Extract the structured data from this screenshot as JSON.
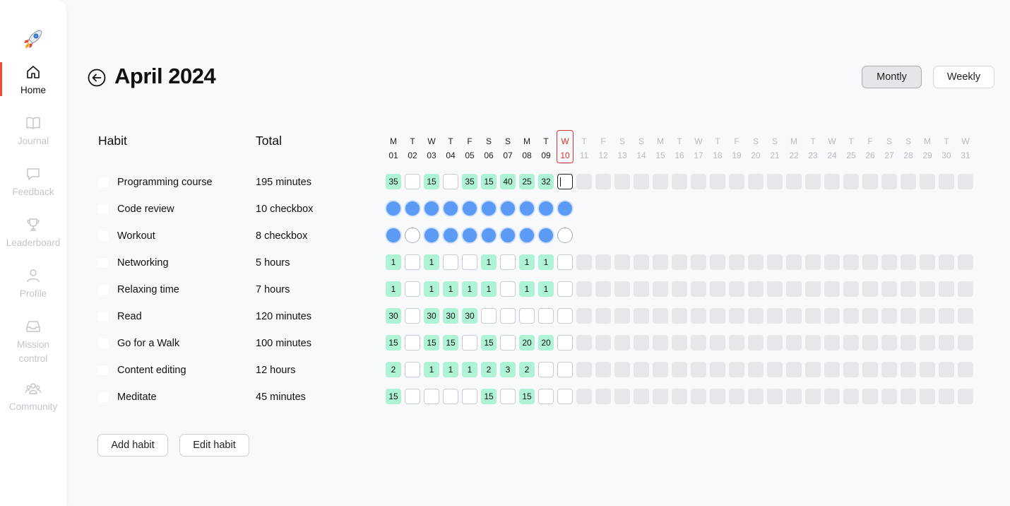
{
  "sidebar": {
    "logo": "rocket-icon",
    "items": [
      {
        "label": "Home",
        "icon": "home-icon",
        "active": true
      },
      {
        "label": "Journal",
        "icon": "book-icon",
        "active": false
      },
      {
        "label": "Feedback",
        "icon": "chat-icon",
        "active": false
      },
      {
        "label": "Leaderboard",
        "icon": "trophy-icon",
        "active": false
      },
      {
        "label": "Profile",
        "icon": "user-icon",
        "active": false
      },
      {
        "label": "Mission control",
        "icon": "inbox-icon",
        "active": false
      },
      {
        "label": "Community",
        "icon": "group-icon",
        "active": false
      }
    ]
  },
  "header": {
    "title": "April 2024",
    "view_monthly": "Montly",
    "view_weekly": "Weekly"
  },
  "table": {
    "habit_header": "Habit",
    "total_header": "Total",
    "today_index": 9,
    "days": [
      {
        "dow": "M",
        "num": "01"
      },
      {
        "dow": "T",
        "num": "02"
      },
      {
        "dow": "W",
        "num": "03"
      },
      {
        "dow": "T",
        "num": "04"
      },
      {
        "dow": "F",
        "num": "05"
      },
      {
        "dow": "S",
        "num": "06"
      },
      {
        "dow": "S",
        "num": "07"
      },
      {
        "dow": "M",
        "num": "08"
      },
      {
        "dow": "T",
        "num": "09"
      },
      {
        "dow": "W",
        "num": "10"
      },
      {
        "dow": "T",
        "num": "11"
      },
      {
        "dow": "F",
        "num": "12"
      },
      {
        "dow": "S",
        "num": "13"
      },
      {
        "dow": "S",
        "num": "14"
      },
      {
        "dow": "M",
        "num": "15"
      },
      {
        "dow": "T",
        "num": "16"
      },
      {
        "dow": "W",
        "num": "17"
      },
      {
        "dow": "T",
        "num": "18"
      },
      {
        "dow": "F",
        "num": "19"
      },
      {
        "dow": "S",
        "num": "20"
      },
      {
        "dow": "S",
        "num": "21"
      },
      {
        "dow": "M",
        "num": "22"
      },
      {
        "dow": "T",
        "num": "23"
      },
      {
        "dow": "W",
        "num": "24"
      },
      {
        "dow": "T",
        "num": "25"
      },
      {
        "dow": "F",
        "num": "26"
      },
      {
        "dow": "S",
        "num": "27"
      },
      {
        "dow": "S",
        "num": "28"
      },
      {
        "dow": "M",
        "num": "29"
      },
      {
        "dow": "T",
        "num": "30"
      },
      {
        "dow": "W",
        "num": "31"
      }
    ],
    "habits": [
      {
        "name": "Programming course",
        "total": "195 minutes",
        "type": "value",
        "entries": [
          "35",
          "",
          "15",
          "",
          "35",
          "15",
          "40",
          "25",
          "32",
          ""
        ]
      },
      {
        "name": "Code review",
        "total": "10 checkbox",
        "type": "checkbox",
        "entries": [
          true,
          true,
          true,
          true,
          true,
          true,
          true,
          true,
          true,
          true
        ]
      },
      {
        "name": "Workout",
        "total": "8 checkbox",
        "type": "checkbox",
        "entries": [
          true,
          false,
          true,
          true,
          true,
          true,
          true,
          true,
          true,
          false
        ]
      },
      {
        "name": "Networking",
        "total": "5 hours",
        "type": "value",
        "entries": [
          "1",
          "",
          "1",
          "",
          "",
          "1",
          "",
          "1",
          "1",
          ""
        ]
      },
      {
        "name": "Relaxing time",
        "total": "7 hours",
        "type": "value",
        "entries": [
          "1",
          "",
          "1",
          "1",
          "1",
          "1",
          "",
          "1",
          "1",
          ""
        ]
      },
      {
        "name": "Read",
        "total": "120 minutes",
        "type": "value",
        "entries": [
          "30",
          "",
          "30",
          "30",
          "30",
          "",
          "",
          "",
          "",
          ""
        ]
      },
      {
        "name": "Go for a Walk",
        "total": "100 minutes",
        "type": "value",
        "entries": [
          "15",
          "",
          "15",
          "15",
          "",
          "15",
          "",
          "20",
          "20",
          ""
        ]
      },
      {
        "name": "Content editing",
        "total": "12 hours",
        "type": "value",
        "entries": [
          "2",
          "",
          "1",
          "1",
          "1",
          "2",
          "3",
          "2",
          "",
          ""
        ]
      },
      {
        "name": "Meditate",
        "total": "45 minutes",
        "type": "value",
        "entries": [
          "15",
          "",
          "",
          "",
          "",
          "15",
          "",
          "15",
          "",
          ""
        ]
      }
    ]
  },
  "actions": {
    "add_habit": "Add habit",
    "edit_habit": "Edit habit"
  }
}
